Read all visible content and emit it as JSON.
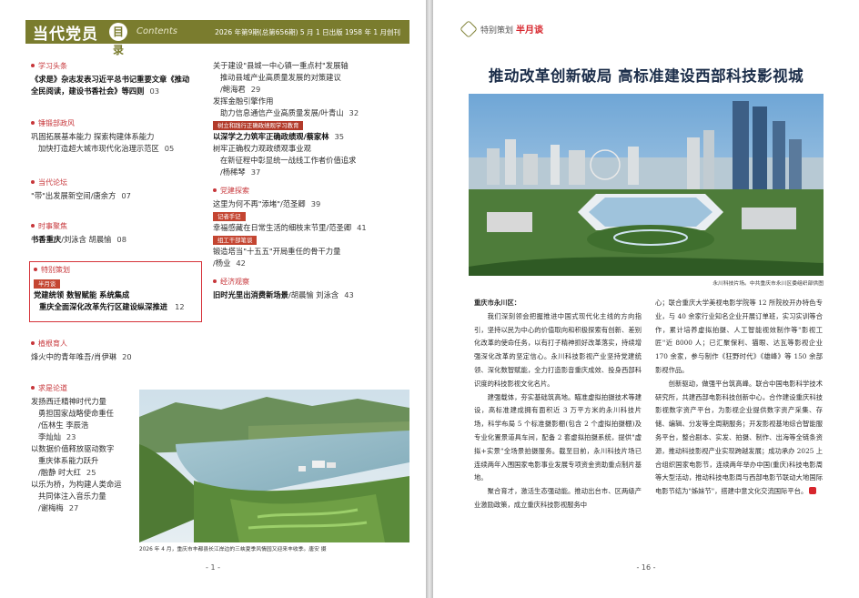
{
  "left_page": {
    "masthead": {
      "logo": "当代党员",
      "mulu": "目录",
      "contents": "Contents",
      "issue": "2026 年第9期(总第656期) 5 月 1 日出版   1958 年 1 月创刊"
    },
    "col1": {
      "xuexi": {
        "title": "学习头条",
        "line1": "《求是》杂志发表习近平总书记重要文章《推动",
        "line2": "全民阅读，建设书香社会》等四则",
        "page": "03"
      },
      "biaogan": {
        "title": "锤锻部政风",
        "line1": "巩固拓展基本能力   探索构建体系能力",
        "line2": "加快打造超大城市现代化治理示范区",
        "page": "05"
      },
      "luntan": {
        "title": "当代论坛",
        "line1": "\"带\"出发展新空间/唐余方",
        "page": "07"
      },
      "shishi": {
        "title": "时事聚焦",
        "line1": "书香重庆",
        "author": "/刘泳含   胡晨愉",
        "page": "08"
      },
      "tebie": {
        "title": "特别策划",
        "tag": "半月谈",
        "line1": "党建统领   数智赋能   系统集成",
        "line2": "重庆全面深化改革先行区建设纵深推进",
        "page": "12"
      },
      "yuren": {
        "title": "植根育人",
        "line1": "烽火中的青年唯吾/肖伊琳",
        "page": "20"
      },
      "qiushi": {
        "title": "求是论道",
        "l1": "发扬西迁精神时代力量",
        "l2": "勇担国家战略使命重任",
        "l3": "/伍林生   李辰浩",
        "l4": "李灿灿",
        "p4": "23",
        "l5": "以数据价值释放驱动数字",
        "l6": "重庆体系能力跃升",
        "l7": "/融静   时大红",
        "p7": "25",
        "l8": "以乐为桥，为构建人类命运",
        "l9": "共同体注入音乐力量",
        "l10": "/谢梅梅",
        "p10": "27"
      }
    },
    "col2": {
      "a1": "关于建设\"县城一中心镇一重点村\"发展轴",
      "a2": "推动县域产业高质量发展的对策建议",
      "a3": "/鲍海君",
      "a3p": "29",
      "a4": "发挥金融引擎作用",
      "a5": "助力信息通信产业高质量发展/叶青山",
      "a5p": "32",
      "tag1": "树立和践行正确政绩观学习教育",
      "a6": "以深学之力筑牢正确政绩观/蔡家林",
      "a6p": "35",
      "a7": "树牢正确权力观政绩观事业观",
      "a8": "在新征程中彰显统一战线工作者价值追求",
      "a9": "/杨稀琴",
      "a9p": "37",
      "tansuo_title": "党建探索",
      "a10": "这里为何不再\"添堵\"/范圣卿",
      "a10p": "39",
      "tag2": "记者手记",
      "a11": "幸福感藏在日常生活的细枝末节里/范圣卿",
      "a11p": "41",
      "tag3": "组工干部笔谈",
      "a12": "锻造塔当\"十五五\"开局重任的骨干力量",
      "a13": "/杨业",
      "a13p": "42",
      "jingji_title": "经济观察",
      "a14": "旧时光里出消费新场景",
      "a14a": "/胡晨愉   刘泳含",
      "a14p": "43"
    },
    "photo_caption": "2026 年 4 月，重庆市丰都县长江岸边的三峡夏季风情园又迎来丰收季。唐安 摄",
    "page_number": "- 1 -"
  },
  "right_page": {
    "header_label": "特别策划",
    "header_brand": "半月谈",
    "headline": "推动改革创新破局   高标准建设西部科技影视城",
    "photo_caption": "永川科技片场。中共重庆市永川区委组织部供图",
    "col_left": {
      "dateline": "重庆市永川区：",
      "p1": "我们深刻领会把握推进中国式现代化主线的方向指引，坚持以民为中心的价值取向和积极探索有创新、差别化改革的使命任务，以有打子精神抓好改革落实，持续增强深化改革的坚定信心。永川科技影视产业坚持党建统领、深化数智赋能，全力打造影音重庆成效、投身西部科识度的科技影视文化名片。",
      "p2": "建强载体，夯实基础筑高地。瞄准虚拟拍摄技术等建设，高标准建成拥有面积近 3 万平方米的永川科技片场，科学布局 5 个标准摄影棚(包含 2 个虚拟拍摄棚)及专业化置景道具车间，配备 2 套虚拟拍摄系统，提供\"虚拟+实景\"全场景拍摄服务。截至目前，永川科技片场已连续两年入围国家电影事业发展专项资金资助重点制片基地。",
      "p3": "聚合育才，激活生态强动能。推动出台市、区两级产业激励政策，成立重庆科技影视服务中"
    },
    "col_right": {
      "p1": "心；联合重庆大学美视电影学院等 12 所院校开办特色专业，与 40 余家行业知名企业开展订单班，实习实训等合作，累计培养虚拟拍摄、人工智能视效制作等\"影视工匠\"近 8000 人；已汇聚保利、猫眼、达瓦等影视企业 170 余家，参与制作《狂野时代》《雄峰》等 150 余部影视作品。",
      "p2": "创新驱动，做强平台筑高峰。联合中国电影科学技术研究所，共建西部电影科技创新中心，合作建设重庆科技影视数字资产平台，为影视企业提供数字资产采集、存储、编辑、分发等全周期服务；开发影视基地综合智能服务平台，整合剧本、实发、拍摄、制作、出海等全链条资源，推动科技影视产业实现跨越发展；成功承办 2025 上合组织国家电影节，连续两年举办中国(重庆)科技电影周等大型活动，推动科技电影周与西部电影节联动大地国际电影节结为\"姊妹节\"，搭建中意文化交流国际平台。"
    },
    "page_number": "- 16 -"
  },
  "colors": {
    "masthead": "#7a7c2e",
    "accent_red": "#c7363a",
    "headline_navy": "#1c2e4a"
  }
}
